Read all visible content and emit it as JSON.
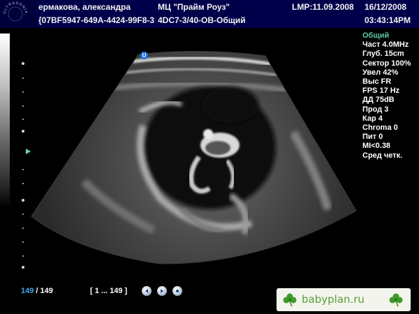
{
  "header": {
    "logo_text": "ULTRASONIX",
    "patient_name": "ермакова, александра",
    "patient_id": "{07BF5947-649A-4424-99F8-3",
    "clinic": "МЦ \"Прайм Роуз\"",
    "preset": "4DC7-3/40-OB-Общий",
    "lmp": "LMP:11.09.2008",
    "date": "16/12/2008",
    "time": "03:43:14PM"
  },
  "orientation_marker": "U",
  "params": [
    "Общий",
    "Част 4.0MHz",
    "Глуб. 15cm",
    "Сектор 100%",
    "Увел 42%",
    "Выс FR",
    "FPS 17 Hz",
    "ДД 75dB",
    "Прод 3",
    "Кар 4",
    "Chroma 0",
    "Пит 0",
    "MI<0.38",
    "Сред четк."
  ],
  "playback": {
    "current_frame": "149",
    "separator": " / ",
    "total_frames": "149",
    "range": "[ 1 ... 149 ]"
  },
  "watermark": {
    "text": "babyplan.ru"
  },
  "colors": {
    "header_bg": "#00004a",
    "param_accent": "#5ec8a4",
    "frame_accent": "#3fa9f5",
    "watermark_text": "#5a9e3a"
  },
  "icons": {
    "prev": "triangle-left",
    "next": "triangle-right",
    "stop": "dot"
  }
}
